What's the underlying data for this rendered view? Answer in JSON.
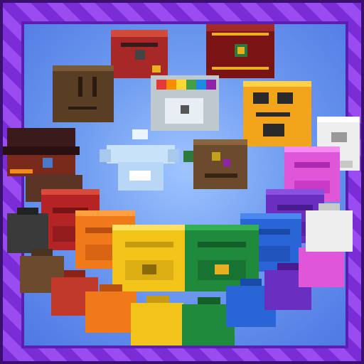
{
  "scene": {
    "colors": {
      "frame_light": "#9a4cf0",
      "frame_dark": "#7a2cd6",
      "sky": "#6f9cf0",
      "sky_light": "#9fc4ff"
    },
    "bags": [
      {
        "icon": "red-chest-icon",
        "color": "#c0392b"
      },
      {
        "icon": "brown-crate-icon",
        "color": "#6b4a2e"
      },
      {
        "icon": "rainbow-crate-icon",
        "color": "#cfd6dc"
      },
      {
        "icon": "treasure-chest-icon",
        "color": "#8e1b1b"
      },
      {
        "icon": "yellow-lock-bag-icon",
        "color": "#f2a51a"
      },
      {
        "icon": "white-bag-icon",
        "color": "#eeeeee"
      },
      {
        "icon": "pink-backpack-icon",
        "color": "#e056d8"
      },
      {
        "icon": "purple-backpack-icon",
        "color": "#6a2fc0"
      },
      {
        "icon": "blue-backpack-icon",
        "color": "#2a65d8"
      },
      {
        "icon": "green-backpack-icon",
        "color": "#1f8a3b"
      },
      {
        "icon": "yellow-backpack-icon",
        "color": "#f2c41a"
      },
      {
        "icon": "orange-backpack-icon",
        "color": "#f07a1a"
      },
      {
        "icon": "red-backpack-icon",
        "color": "#b52424"
      },
      {
        "icon": "fancy-hat-bag-icon",
        "color": "#3a2a2a"
      },
      {
        "icon": "crystal-trophy-icon",
        "color": "#cfe7ff"
      },
      {
        "icon": "leather-satchel-icon",
        "color": "#6b4a2e"
      },
      {
        "icon": "sack-black-icon",
        "color": "#3a3a3a"
      },
      {
        "icon": "sack-brown-icon",
        "color": "#6b4a2e"
      },
      {
        "icon": "sack-red-icon",
        "color": "#c0392b"
      },
      {
        "icon": "sack-orange-icon",
        "color": "#f07a1a"
      },
      {
        "icon": "sack-yellow-icon",
        "color": "#f2c41a"
      },
      {
        "icon": "sack-green-icon",
        "color": "#1f8a3b"
      },
      {
        "icon": "sack-blue-icon",
        "color": "#2a65d8"
      },
      {
        "icon": "sack-purple-icon",
        "color": "#6a2fc0"
      },
      {
        "icon": "sack-pink-icon",
        "color": "#e056d8"
      },
      {
        "icon": "sack-white-icon",
        "color": "#eeeeee"
      }
    ]
  }
}
